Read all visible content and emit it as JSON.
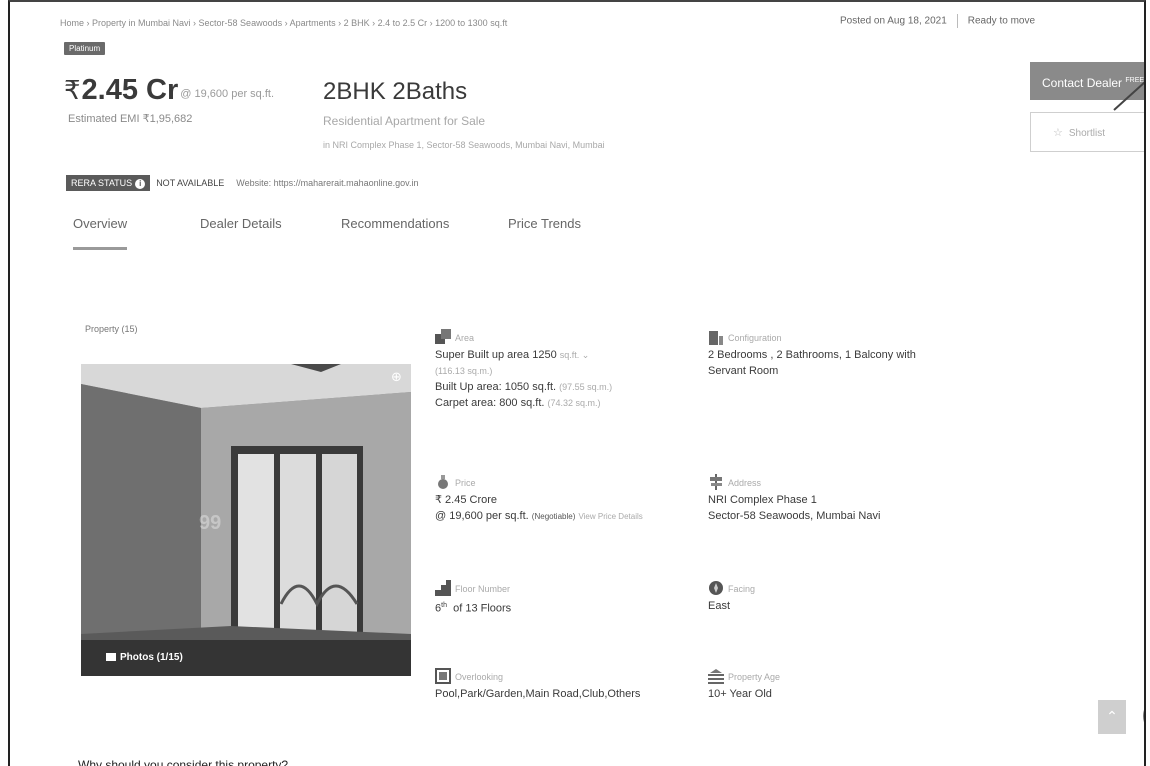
{
  "breadcrumb": "Home › Property in Mumbai Navi › Sector-58 Seawoods › Apartments › 2 BHK › 2.4 to 2.5 Cr › 1200 to 1300 sq.ft",
  "posted": {
    "date": "Posted on Aug 18, 2021",
    "status": "Ready to move"
  },
  "badge": "Platinum",
  "price": {
    "rupee": "₹",
    "amount": "2.45 Cr",
    "per_sqft": "@ 19,600 per sq.ft."
  },
  "emi": "Estimated EMI ₹1,95,682",
  "listing": {
    "title": "2BHK 2Baths",
    "subtitle": "Residential Apartment for Sale",
    "address": "in NRI Complex Phase 1, Sector-58 Seawoods,  Mumbai Navi, Mumbai"
  },
  "actions": {
    "contact": "Contact Dealer",
    "contact_badge": "FREE",
    "shortlist": "Shortlist"
  },
  "rera": {
    "label": "RERA STATUS",
    "value": "NOT AVAILABLE",
    "website": "Website: https://maharerait.mahaonline.gov.in"
  },
  "tabs": [
    {
      "label": "Overview",
      "active": true
    },
    {
      "label": "Dealer Details",
      "active": false
    },
    {
      "label": "Recommendations",
      "active": false
    },
    {
      "label": "Price Trends",
      "active": false
    }
  ],
  "property_count": "Property (15)",
  "photo": {
    "label": "Photos (1/15)",
    "watermark": "99"
  },
  "specs": {
    "area": {
      "heading": "Area",
      "super_built": "Super Built up area 1250",
      "unit": "sq.ft.",
      "super_built_sqm": "(116.13 sq.m.)",
      "built_up": "Built Up area: 1050 sq.ft.",
      "built_up_sqm": "(97.55 sq.m.)",
      "carpet": "Carpet area: 800 sq.ft.",
      "carpet_sqm": "(74.32 sq.m.)"
    },
    "configuration": {
      "heading": "Configuration",
      "line1": "2 Bedrooms , 2 Bathrooms, 1 Balcony with",
      "line2": "Servant Room"
    },
    "price": {
      "heading": "Price",
      "line1": "₹ 2.45 Crore",
      "line2": "@ 19,600 per sq.ft.",
      "negotiable": "(Negotiable)",
      "link": "View Price Details"
    },
    "address": {
      "heading": "Address",
      "line1": "NRI Complex Phase 1",
      "line2": "Sector-58 Seawoods, Mumbai Navi"
    },
    "floor": {
      "heading": "Floor Number",
      "num": "6",
      "suffix": "th",
      "of": "of 13 Floors"
    },
    "facing": {
      "heading": "Facing",
      "value": "East"
    },
    "overlooking": {
      "heading": "Overlooking",
      "value": "Pool,Park/Garden,Main Road,Club,Others"
    },
    "age": {
      "heading": "Property Age",
      "value": "10+ Year Old"
    }
  },
  "why": "Why should you consider this property?",
  "colors": {
    "accent": "#8a8a8a",
    "text": "#3a3a3a",
    "muted": "#aaaaaa"
  }
}
